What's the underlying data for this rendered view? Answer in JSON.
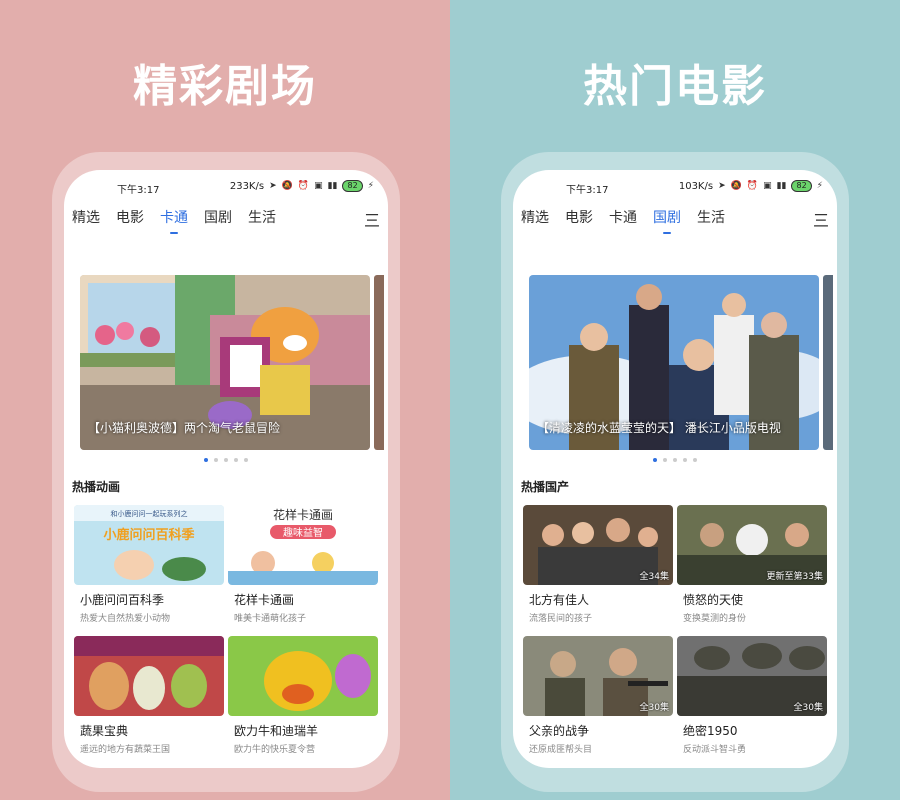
{
  "left": {
    "headline": "精彩剧场",
    "status": {
      "time": "下午3:17",
      "speed": "233K/s",
      "battery": "82"
    },
    "tabs": [
      "精选",
      "电影",
      "卡通",
      "国剧",
      "生活"
    ],
    "active_tab": 2,
    "menu_icon": "三",
    "banner": {
      "caption": "【小猫利奥波德】两个淘气老鼠冒险"
    },
    "section_title": "热播动画",
    "cards": [
      {
        "title": "小鹿问问百科季",
        "subtitle": "热爱大自然热爱小动物",
        "thumb_text": "小鹿问问百科季",
        "thumb_header": "和小鹿问问一起玩系列之"
      },
      {
        "title": "花样卡通画",
        "subtitle": "唯美卡通萌化孩子",
        "thumb_text": "花样卡通画",
        "thumb_badge": "趣味益智"
      },
      {
        "title": "蔬果宝典",
        "subtitle": "遥远的地方有蔬菜王国"
      },
      {
        "title": "欧力牛和迪瑞羊",
        "subtitle": "欧力牛的快乐夏令营"
      }
    ]
  },
  "right": {
    "headline": "热门电影",
    "status": {
      "time": "下午3:17",
      "speed": "103K/s",
      "battery": "82"
    },
    "tabs": [
      "精选",
      "电影",
      "卡通",
      "国剧",
      "生活"
    ],
    "active_tab": 3,
    "menu_icon": "三",
    "banner": {
      "caption": "【清凌凌的水蓝莹莹的天】 潘长江小品版电视"
    },
    "section_title": "热播国产",
    "cards": [
      {
        "title": "北方有佳人",
        "subtitle": "流落民间的孩子",
        "episodes": "全34集"
      },
      {
        "title": "愤怒的天使",
        "subtitle": "变换莫测的身份",
        "episodes": "更新至第33集"
      },
      {
        "title": "父亲的战争",
        "subtitle": "还原成匪帮头目",
        "episodes": "全30集"
      },
      {
        "title": "绝密1950",
        "subtitle": "反动派斗智斗勇",
        "episodes": "全30集"
      }
    ]
  }
}
